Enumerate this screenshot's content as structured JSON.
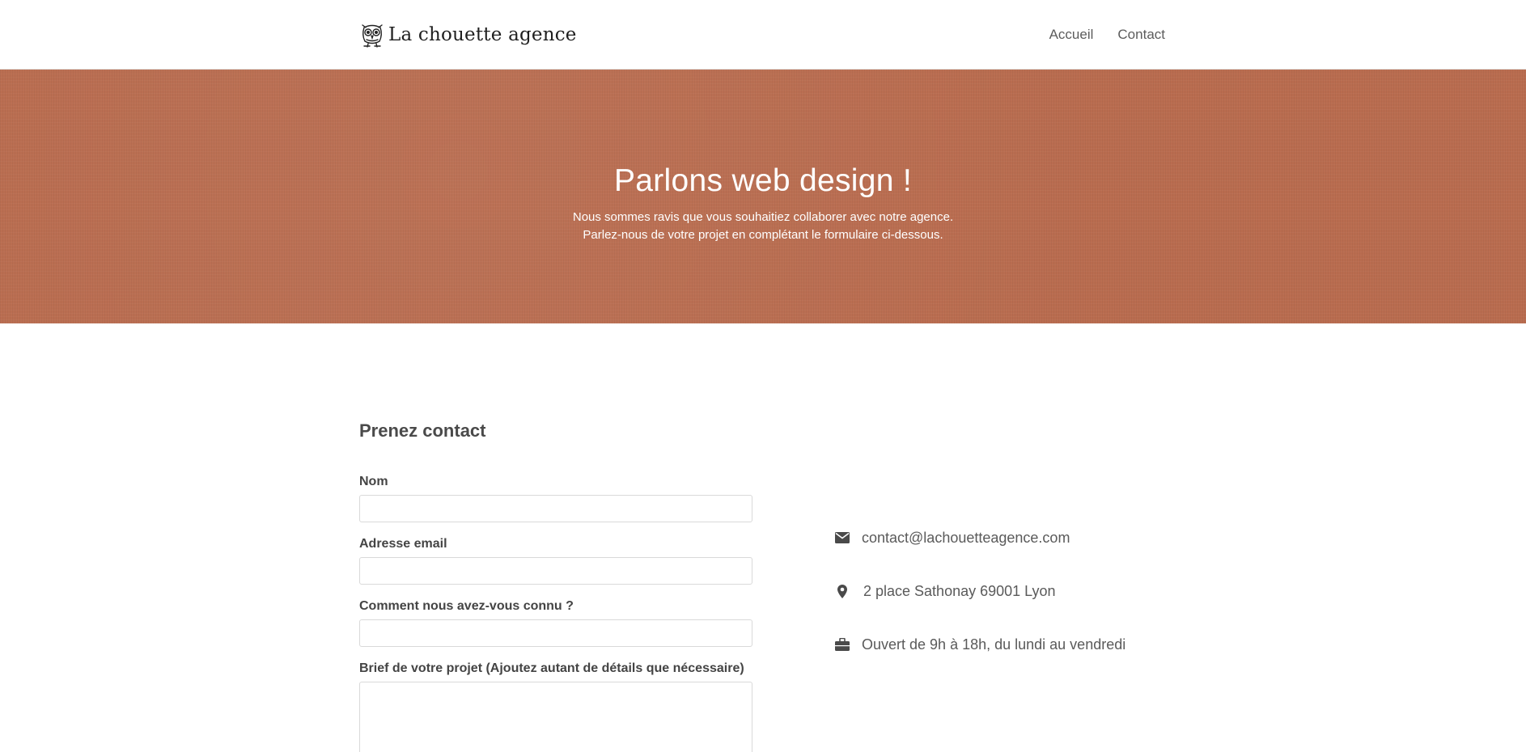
{
  "header": {
    "logo_text": "La chouette agence",
    "nav": [
      {
        "label": "Accueil"
      },
      {
        "label": "Contact"
      }
    ]
  },
  "hero": {
    "title": "Parlons web design !",
    "line1": "Nous sommes ravis que vous souhaitiez collaborer avec notre agence.",
    "line2": "Parlez-nous de votre projet en complétant le formulaire ci-dessous.",
    "background_color": "#b96c4f"
  },
  "contact": {
    "title": "Prenez contact",
    "fields": [
      {
        "label": "Nom",
        "value": ""
      },
      {
        "label": "Adresse email",
        "value": ""
      },
      {
        "label": "Comment nous avez-vous connu ?",
        "value": ""
      },
      {
        "label": "Brief de votre projet (Ajoutez autant de détails que nécessaire)",
        "value": ""
      }
    ],
    "info": [
      {
        "icon": "envelope-icon",
        "text": "contact@lachouetteagence.com"
      },
      {
        "icon": "map-marker-icon",
        "text": "2 place Sathonay 69001 Lyon"
      },
      {
        "icon": "briefcase-icon",
        "text": "Ouvert de 9h à 18h, du lundi au vendredi"
      }
    ]
  }
}
